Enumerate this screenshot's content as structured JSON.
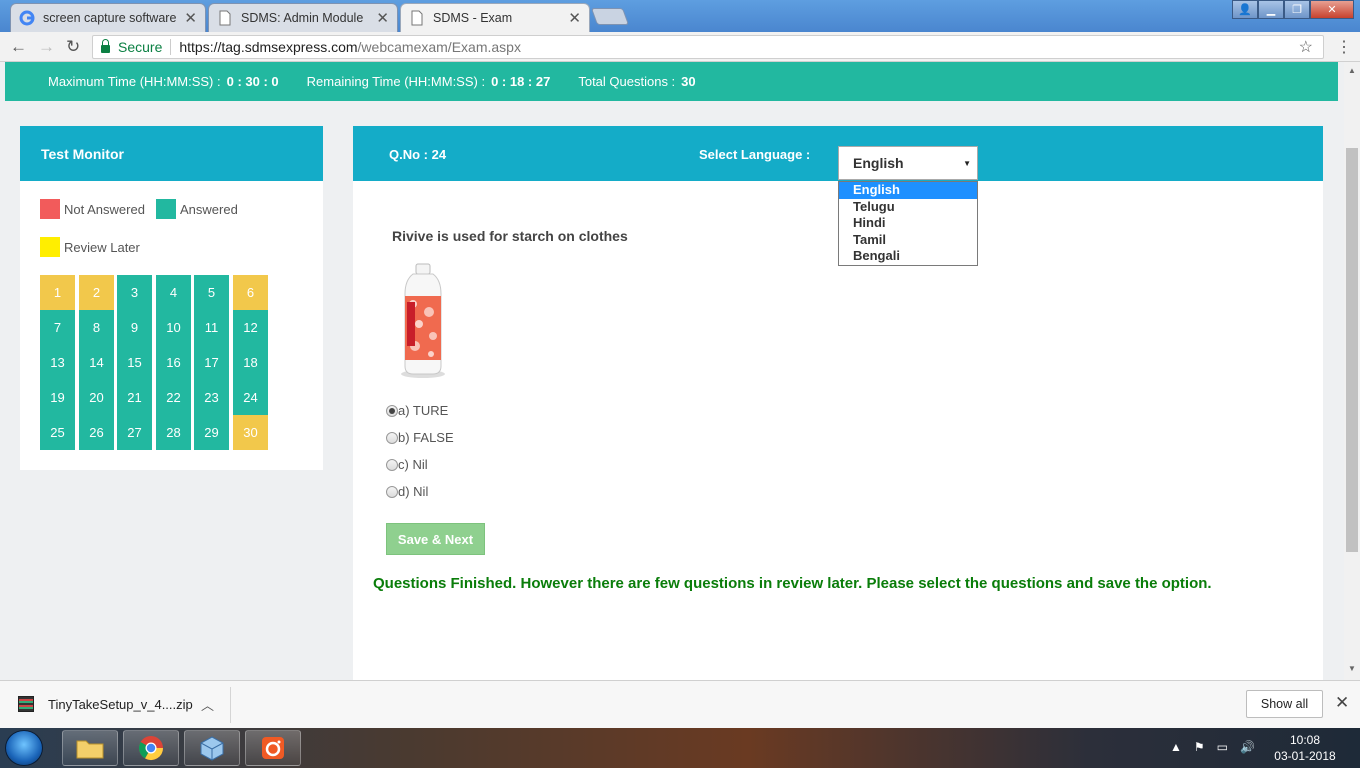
{
  "browser": {
    "tabs": [
      {
        "label": "screen capture software",
        "active": false
      },
      {
        "label": "SDMS: Admin Module",
        "active": false
      },
      {
        "label": "SDMS - Exam",
        "active": true
      }
    ],
    "secure_label": "Secure",
    "url_host": "https://tag.sdmsexpress.com",
    "url_path": "/webcamexam/Exam.aspx"
  },
  "timebar": {
    "max_time_label": "Maximum Time (HH:MM:SS) :",
    "max_time_value": "0 : 30 : 0",
    "remaining_label": "Remaining Time (HH:MM:SS) :",
    "remaining_value": "0 : 18 : 27",
    "total_label": "Total Questions :",
    "total_value": "30"
  },
  "monitor": {
    "title": "Test Monitor",
    "legend": {
      "not_answered": "Not Answered",
      "answered": "Answered",
      "review_later": "Review Later"
    },
    "colors": {
      "not_answered": "#f25b5b",
      "answered": "#22b8a0",
      "review_later": "#ffee00",
      "review_cell": "#f2c84b"
    },
    "questions": [
      {
        "n": "1",
        "status": "review"
      },
      {
        "n": "2",
        "status": "review"
      },
      {
        "n": "3",
        "status": "answered"
      },
      {
        "n": "4",
        "status": "answered"
      },
      {
        "n": "5",
        "status": "answered"
      },
      {
        "n": "6",
        "status": "review"
      },
      {
        "n": "7",
        "status": "answered"
      },
      {
        "n": "8",
        "status": "answered"
      },
      {
        "n": "9",
        "status": "answered"
      },
      {
        "n": "10",
        "status": "answered"
      },
      {
        "n": "11",
        "status": "answered"
      },
      {
        "n": "12",
        "status": "answered"
      },
      {
        "n": "13",
        "status": "answered"
      },
      {
        "n": "14",
        "status": "answered"
      },
      {
        "n": "15",
        "status": "answered"
      },
      {
        "n": "16",
        "status": "answered"
      },
      {
        "n": "17",
        "status": "answered"
      },
      {
        "n": "18",
        "status": "answered"
      },
      {
        "n": "19",
        "status": "answered"
      },
      {
        "n": "20",
        "status": "answered"
      },
      {
        "n": "21",
        "status": "answered"
      },
      {
        "n": "22",
        "status": "answered"
      },
      {
        "n": "23",
        "status": "answered"
      },
      {
        "n": "24",
        "status": "answered"
      },
      {
        "n": "25",
        "status": "answered"
      },
      {
        "n": "26",
        "status": "answered"
      },
      {
        "n": "27",
        "status": "answered"
      },
      {
        "n": "28",
        "status": "answered"
      },
      {
        "n": "29",
        "status": "answered"
      },
      {
        "n": "30",
        "status": "review"
      }
    ]
  },
  "question": {
    "qno": "Q.No : 24",
    "language_label": "Select Language :",
    "language_selected": "English",
    "language_options": [
      "English",
      "Telugu",
      "Hindi",
      "Tamil",
      "Bengali"
    ],
    "text": "Rivive is used for starch on clothes",
    "options": [
      {
        "label": "a) TURE",
        "checked": true
      },
      {
        "label": "b) FALSE",
        "checked": false
      },
      {
        "label": "c) Nil",
        "checked": false
      },
      {
        "label": "d) Nil",
        "checked": false
      }
    ],
    "save_label": "Save & Next",
    "finished_message": "Questions Finished. However there are few questions in review later. Please select the questions and save the option."
  },
  "downloads": {
    "file_name": "TinyTakeSetup_v_4....zip",
    "show_all": "Show all"
  },
  "taskbar": {
    "time": "10:08",
    "date": "03-01-2018"
  }
}
